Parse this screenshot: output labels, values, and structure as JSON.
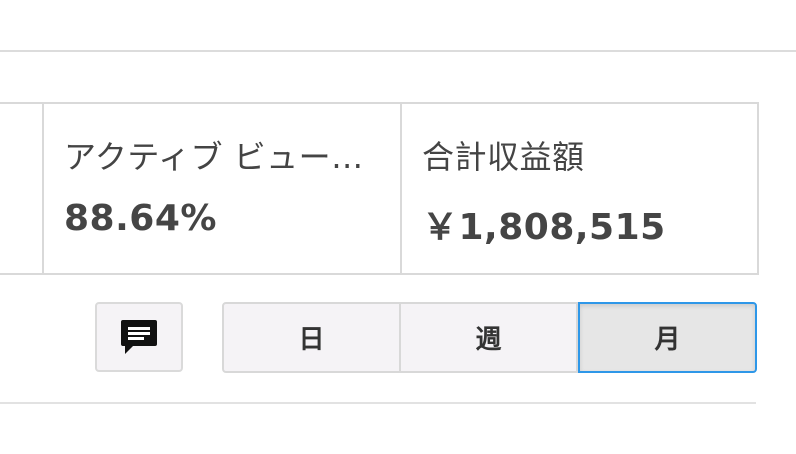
{
  "metrics": {
    "active_view": {
      "label": "アクティブ ビュー…",
      "value": "88.64%"
    },
    "total_revenue": {
      "label": "合計収益額",
      "value": "￥1,808,515"
    }
  },
  "toolbar": {
    "comment_icon": "comment-icon",
    "periods": [
      {
        "label": "日",
        "selected": false
      },
      {
        "label": "週",
        "selected": false
      },
      {
        "label": "月",
        "selected": true
      }
    ]
  },
  "colors": {
    "selected_border": "#2e97e8",
    "text": "#454545",
    "divider": "#d9d9d9"
  }
}
